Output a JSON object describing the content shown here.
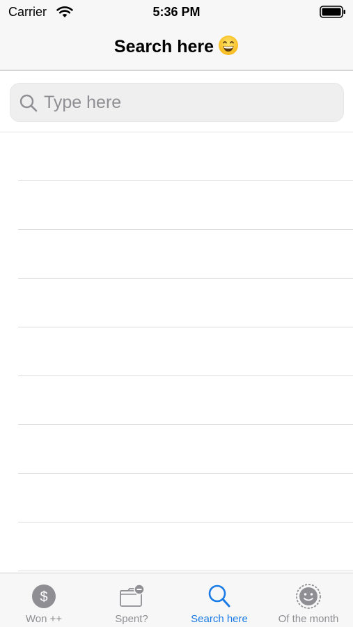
{
  "status": {
    "carrier": "Carrier",
    "time": "5:36 PM"
  },
  "nav": {
    "title": "Search here",
    "emoji_icon": "grinning-face-icon"
  },
  "search": {
    "placeholder": "Type here",
    "value": ""
  },
  "list": {
    "row_count": 9
  },
  "tabs": [
    {
      "label": "Won ++",
      "icon": "dollar-circle-icon",
      "active": false
    },
    {
      "label": "Spent?",
      "icon": "wallet-minus-icon",
      "active": false
    },
    {
      "label": "Search here",
      "icon": "search-icon",
      "active": true
    },
    {
      "label": "Of the month",
      "icon": "smiley-badge-icon",
      "active": false
    }
  ],
  "colors": {
    "accent": "#1a7be6",
    "inactive": "#8e8e93"
  }
}
